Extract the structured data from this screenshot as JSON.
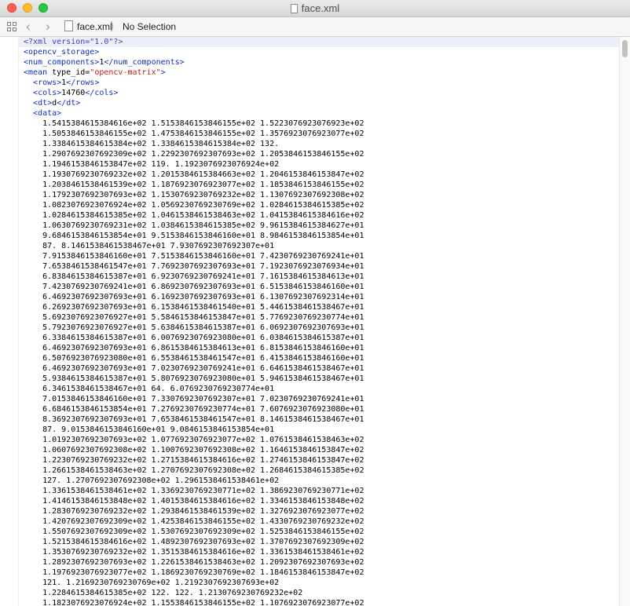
{
  "window": {
    "title": "face.xml"
  },
  "jumpbar": {
    "file": "face.xml",
    "selection": "No Selection"
  },
  "editor": {
    "header_lines": [
      [
        {
          "c": "t-decl",
          "t": "<?xml version=\"1.0\"?>"
        }
      ],
      [
        {
          "c": "t-tag",
          "t": "<opencv_storage>"
        }
      ],
      [
        {
          "c": "t-tag",
          "t": "<num_components>"
        },
        {
          "c": "t-attr",
          "t": "1"
        },
        {
          "c": "t-tag",
          "t": "</num_components>"
        }
      ],
      [
        {
          "c": "t-tag",
          "t": "<mean "
        },
        {
          "c": "t-attr",
          "t": "type_id="
        },
        {
          "c": "t-val",
          "t": "\"opencv-matrix\""
        },
        {
          "c": "t-tag",
          "t": ">"
        }
      ],
      [
        {
          "c": "t-attr",
          "t": "  "
        },
        {
          "c": "t-tag",
          "t": "<rows>"
        },
        {
          "c": "t-attr",
          "t": "1"
        },
        {
          "c": "t-tag",
          "t": "</rows>"
        }
      ],
      [
        {
          "c": "t-attr",
          "t": "  "
        },
        {
          "c": "t-tag",
          "t": "<cols>"
        },
        {
          "c": "t-attr",
          "t": "14760"
        },
        {
          "c": "t-tag",
          "t": "</cols>"
        }
      ],
      [
        {
          "c": "t-attr",
          "t": "  "
        },
        {
          "c": "t-tag",
          "t": "<dt>"
        },
        {
          "c": "t-attr",
          "t": "d"
        },
        {
          "c": "t-tag",
          "t": "</dt>"
        }
      ],
      [
        {
          "c": "t-attr",
          "t": "  "
        },
        {
          "c": "t-tag",
          "t": "<data>"
        }
      ]
    ],
    "data_lines": [
      "    1.5415384615384616e+02 1.5153846153846155e+02 1.5223076923076923e+02",
      "    1.5053846153846155e+02 1.4753846153846155e+02 1.3576923076923077e+02",
      "    1.3384615384615384e+02 1.3384615384615384e+02 132.",
      "    1.2907692307692309e+02 1.2292307692307693e+02 1.2053846153846155e+02",
      "    1.1946153846153847e+02 119. 1.1923076923076924e+02",
      "    1.1930769230769232e+02 1.2015384615384663e+02 1.2046153846153847e+02",
      "    1.2038461538461539e+02 1.1876923076923077e+02 1.1853846153846155e+02",
      "    1.1792307692307693e+02 1.1530769230769232e+02 1.1307692307692308e+02",
      "    1.0823076923076924e+02 1.0569230769230769e+02 1.0284615384615385e+02",
      "    1.0284615384615385e+02 1.0461538461538463e+02 1.0415384615384616e+02",
      "    1.0630769230769231e+02 1.0384615384615385e+02 9.9615384615384627e+01",
      "    9.6846153846153854e+01 9.5153846153846160e+01 8.9846153846153854e+01",
      "    87. 8.1461538461538467e+01 7.9307692307692307e+01",
      "    7.9153846153846160e+01 7.5153846153846160e+01 7.4230769230769241e+01",
      "    7.6538461538461547e+01 7.7692307692307693e+01 7.1923076923076934e+01",
      "    6.8384615384615387e+01 6.9230769230769241e+01 7.1615384615384613e+01",
      "    7.4230769230769241e+01 6.8692307692307693e+01 6.5153846153846160e+01",
      "    6.4692307692307693e+01 6.1692307692307693e+01 6.1307692307692314e+01",
      "    6.2692307692307693e+01 6.1538461538461540e+01 5.4461538461538467e+01",
      "    5.6923076923076927e+01 5.5846153846153847e+01 5.7769230769230774e+01",
      "    5.7923076923076927e+01 5.6384615384615387e+01 6.0692307692307693e+01",
      "    6.3384615384615387e+01 6.0076923076923080e+01 6.0384615384615387e+01",
      "    6.4692307692307693e+01 6.8615384615384613e+01 6.8153846153846160e+01",
      "    6.5076923076923080e+01 6.5538461538461547e+01 6.4153846153846160e+01",
      "    6.4692307692307693e+01 7.0230769230769241e+01 6.6461538461538467e+01",
      "    5.9384615384615387e+01 5.8076923076923080e+01 5.9461538461538467e+01",
      "    6.3461538461538467e+01 64. 6.0769230769230774e+01",
      "    7.0153846153846160e+01 7.3307692307692307e+01 7.0230769230769241e+01",
      "    6.6846153846153854e+01 7.2769230769230774e+01 7.6076923076923080e+01",
      "    8.3692307692307693e+01 7.6538461538461547e+01 8.1461538461538467e+01",
      "    87. 9.0153846153846160e+01 9.0846153846153854e+01",
      "    1.0192307692307693e+02 1.0776923076923077e+02 1.0761538461538463e+02",
      "    1.0607692307692308e+02 1.1007692307692308e+02 1.1646153846153847e+02",
      "    1.2230769230769232e+02 1.2715384615384616e+02 1.2746153846153847e+02",
      "    1.2661538461538463e+02 1.2707692307692308e+02 1.2684615384615385e+02",
      "    127. 1.2707692307692308e+02 1.2961538461538461e+02",
      "    1.3361538461538461e+02 1.3369230769230771e+02 1.3869230769230771e+02",
      "    1.4146153846153848e+02 1.4015384615384616e+02 1.3346153846153848e+02",
      "    1.2830769230769232e+02 1.2938461538461539e+02 1.3276923076923077e+02",
      "    1.4207692307692309e+02 1.4253846153846155e+02 1.4330769230769232e+02",
      "    1.5507692307692309e+02 1.5307692307692309e+02 1.5253846153846155e+02",
      "    1.5215384615384616e+02 1.4892307692307693e+02 1.3707692307692309e+02",
      "    1.3530769230769232e+02 1.3515384615384616e+02 1.3361538461538461e+02",
      "    1.2892307692307693e+02 1.2261538461538463e+02 1.2092307692307693e+02",
      "    1.1976923076923077e+02 1.1869230769230769e+02 1.1846153846153847e+02",
      "    121. 1.2169230769230769e+02 1.2192307692307693e+02",
      "    1.2284615384615385e+02 122. 122. 1.2130769230769232e+02",
      "    1.1823076923076924e+02 1.1553846153846155e+02 1.1076923076923077e+02"
    ]
  }
}
